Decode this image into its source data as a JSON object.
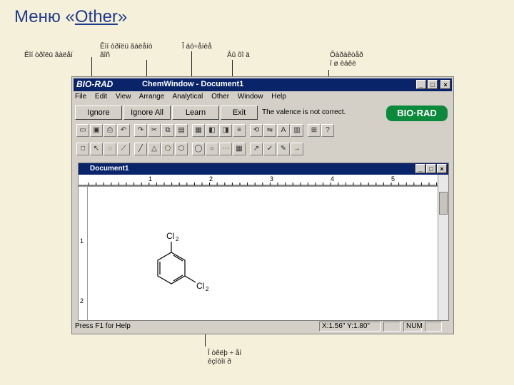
{
  "slide": {
    "title_prefix": "Меню «",
    "title_menu": "Other",
    "title_suffix": "»"
  },
  "callouts": [
    "Êîí òðîëü âàëåí",
    "Êîí òðîëü âàëåíò\nãîñ",
    "Î áó÷åíèå",
    "Âû õî ä",
    "Õàðàêòåð\nî ø èáêè",
    "Î òêëþ ÷ åí\nèçîòîï ð"
  ],
  "window": {
    "brand_logo": "BIO-RAD",
    "title": "ChemWindow - Document1",
    "controls": [
      "_",
      "□",
      "×"
    ]
  },
  "menu": [
    "File",
    "Edit",
    "View",
    "Arrange",
    "Analytical",
    "Other",
    "Window",
    "Help"
  ],
  "command_bar": {
    "buttons": [
      "Ignore",
      "Ignore All",
      "Learn",
      "Exit"
    ],
    "message": "The valence is not correct.",
    "brand": "BIO·RAD"
  },
  "toolbar1_icons": [
    "open-icon",
    "save-icon",
    "print-icon",
    "undo-icon",
    "redo-icon",
    "cut-icon",
    "copy-icon",
    "paste-icon",
    "group-icon",
    "front-icon",
    "back-icon",
    "align-icon",
    "rotate-icon",
    "flip-icon",
    "text-icon",
    "table-icon",
    "grid-icon",
    "help-icon"
  ],
  "toolbar2_icons": [
    "new-icon",
    "select-icon",
    "lasso-icon",
    "bond-icon",
    "line-icon",
    "ring3-icon",
    "ring5-icon",
    "ring6-icon",
    "ring7-icon",
    "ring8-icon",
    "chain-icon",
    "grid-icon",
    "arrow-icon",
    "check-icon",
    "pencil-icon",
    "arrow-right-icon"
  ],
  "document": {
    "title": "Document1",
    "ruler_marks": [
      "1",
      "2",
      "3",
      "4",
      "5"
    ],
    "vruler_marks": [
      "1",
      "2"
    ],
    "atom_top": "Cl",
    "atom_top_sub": "2",
    "atom_right": "Cl",
    "atom_right_sub": "2"
  },
  "status": {
    "help": "Press F1 for Help",
    "coords": "X:1.56\" Y:1.80\"",
    "num": "NUM"
  }
}
